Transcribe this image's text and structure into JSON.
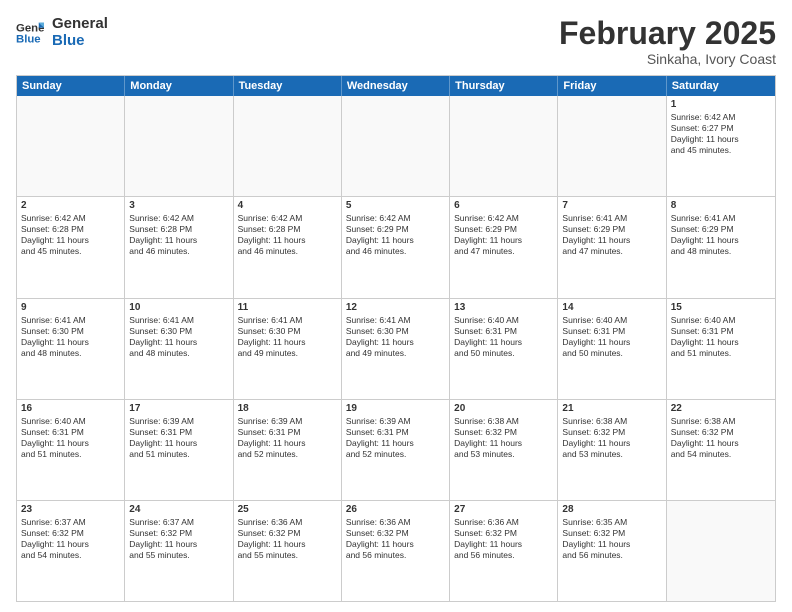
{
  "logo": {
    "line1": "General",
    "line2": "Blue"
  },
  "title": "February 2025",
  "subtitle": "Sinkaha, Ivory Coast",
  "weekdays": [
    "Sunday",
    "Monday",
    "Tuesday",
    "Wednesday",
    "Thursday",
    "Friday",
    "Saturday"
  ],
  "rows": [
    [
      {
        "day": "",
        "info": ""
      },
      {
        "day": "",
        "info": ""
      },
      {
        "day": "",
        "info": ""
      },
      {
        "day": "",
        "info": ""
      },
      {
        "day": "",
        "info": ""
      },
      {
        "day": "",
        "info": ""
      },
      {
        "day": "1",
        "info": "Sunrise: 6:42 AM\nSunset: 6:27 PM\nDaylight: 11 hours\nand 45 minutes."
      }
    ],
    [
      {
        "day": "2",
        "info": "Sunrise: 6:42 AM\nSunset: 6:28 PM\nDaylight: 11 hours\nand 45 minutes."
      },
      {
        "day": "3",
        "info": "Sunrise: 6:42 AM\nSunset: 6:28 PM\nDaylight: 11 hours\nand 46 minutes."
      },
      {
        "day": "4",
        "info": "Sunrise: 6:42 AM\nSunset: 6:28 PM\nDaylight: 11 hours\nand 46 minutes."
      },
      {
        "day": "5",
        "info": "Sunrise: 6:42 AM\nSunset: 6:29 PM\nDaylight: 11 hours\nand 46 minutes."
      },
      {
        "day": "6",
        "info": "Sunrise: 6:42 AM\nSunset: 6:29 PM\nDaylight: 11 hours\nand 47 minutes."
      },
      {
        "day": "7",
        "info": "Sunrise: 6:41 AM\nSunset: 6:29 PM\nDaylight: 11 hours\nand 47 minutes."
      },
      {
        "day": "8",
        "info": "Sunrise: 6:41 AM\nSunset: 6:29 PM\nDaylight: 11 hours\nand 48 minutes."
      }
    ],
    [
      {
        "day": "9",
        "info": "Sunrise: 6:41 AM\nSunset: 6:30 PM\nDaylight: 11 hours\nand 48 minutes."
      },
      {
        "day": "10",
        "info": "Sunrise: 6:41 AM\nSunset: 6:30 PM\nDaylight: 11 hours\nand 48 minutes."
      },
      {
        "day": "11",
        "info": "Sunrise: 6:41 AM\nSunset: 6:30 PM\nDaylight: 11 hours\nand 49 minutes."
      },
      {
        "day": "12",
        "info": "Sunrise: 6:41 AM\nSunset: 6:30 PM\nDaylight: 11 hours\nand 49 minutes."
      },
      {
        "day": "13",
        "info": "Sunrise: 6:40 AM\nSunset: 6:31 PM\nDaylight: 11 hours\nand 50 minutes."
      },
      {
        "day": "14",
        "info": "Sunrise: 6:40 AM\nSunset: 6:31 PM\nDaylight: 11 hours\nand 50 minutes."
      },
      {
        "day": "15",
        "info": "Sunrise: 6:40 AM\nSunset: 6:31 PM\nDaylight: 11 hours\nand 51 minutes."
      }
    ],
    [
      {
        "day": "16",
        "info": "Sunrise: 6:40 AM\nSunset: 6:31 PM\nDaylight: 11 hours\nand 51 minutes."
      },
      {
        "day": "17",
        "info": "Sunrise: 6:39 AM\nSunset: 6:31 PM\nDaylight: 11 hours\nand 51 minutes."
      },
      {
        "day": "18",
        "info": "Sunrise: 6:39 AM\nSunset: 6:31 PM\nDaylight: 11 hours\nand 52 minutes."
      },
      {
        "day": "19",
        "info": "Sunrise: 6:39 AM\nSunset: 6:31 PM\nDaylight: 11 hours\nand 52 minutes."
      },
      {
        "day": "20",
        "info": "Sunrise: 6:38 AM\nSunset: 6:32 PM\nDaylight: 11 hours\nand 53 minutes."
      },
      {
        "day": "21",
        "info": "Sunrise: 6:38 AM\nSunset: 6:32 PM\nDaylight: 11 hours\nand 53 minutes."
      },
      {
        "day": "22",
        "info": "Sunrise: 6:38 AM\nSunset: 6:32 PM\nDaylight: 11 hours\nand 54 minutes."
      }
    ],
    [
      {
        "day": "23",
        "info": "Sunrise: 6:37 AM\nSunset: 6:32 PM\nDaylight: 11 hours\nand 54 minutes."
      },
      {
        "day": "24",
        "info": "Sunrise: 6:37 AM\nSunset: 6:32 PM\nDaylight: 11 hours\nand 55 minutes."
      },
      {
        "day": "25",
        "info": "Sunrise: 6:36 AM\nSunset: 6:32 PM\nDaylight: 11 hours\nand 55 minutes."
      },
      {
        "day": "26",
        "info": "Sunrise: 6:36 AM\nSunset: 6:32 PM\nDaylight: 11 hours\nand 56 minutes."
      },
      {
        "day": "27",
        "info": "Sunrise: 6:36 AM\nSunset: 6:32 PM\nDaylight: 11 hours\nand 56 minutes."
      },
      {
        "day": "28",
        "info": "Sunrise: 6:35 AM\nSunset: 6:32 PM\nDaylight: 11 hours\nand 56 minutes."
      },
      {
        "day": "",
        "info": ""
      }
    ]
  ]
}
